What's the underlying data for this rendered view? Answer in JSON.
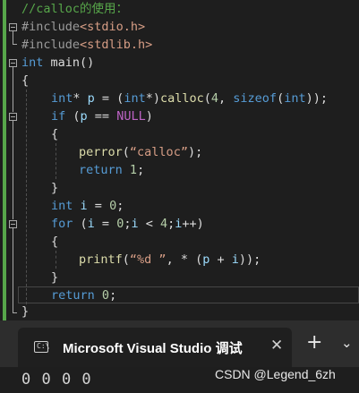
{
  "editor": {
    "comment": "//calloc的使用：",
    "inc1_kw": "#include",
    "inc1_file": "<stdio.h>",
    "inc2_kw": "#include",
    "inc2_file": "<stdlib.h>",
    "main_type": "int",
    "main_name": " main()",
    "brace_open": "{",
    "l5_a": "int",
    "l5_b": "* ",
    "l5_c": "p",
    "l5_d": " = (",
    "l5_e": "int",
    "l5_f": "*)",
    "l5_g": "calloc",
    "l5_h": "(",
    "l5_i": "4",
    "l5_j": ", ",
    "l5_k": "sizeof",
    "l5_l": "(",
    "l5_m": "int",
    "l5_n": "));",
    "l6_a": "if",
    "l6_b": " (",
    "l6_c": "p",
    "l6_d": " == ",
    "l6_e": "NULL",
    "l6_f": ")",
    "l7": "{",
    "l8_a": "perror",
    "l8_b": "(",
    "l8_c": "“calloc”",
    "l8_d": ");",
    "l9_a": "return",
    "l9_b": " ",
    "l9_c": "1",
    "l9_d": ";",
    "l10": "}",
    "l11_a": "int",
    "l11_b": " ",
    "l11_c": "i",
    "l11_d": " = ",
    "l11_e": "0",
    "l11_f": ";",
    "l12_a": "for",
    "l12_b": " (",
    "l12_c": "i",
    "l12_d": " = ",
    "l12_e": "0",
    "l12_f": ";",
    "l12_g": "i",
    "l12_h": " < ",
    "l12_i": "4",
    "l12_j": ";",
    "l12_k": "i",
    "l12_l": "++)",
    "l13": "{",
    "l14_a": "printf",
    "l14_b": "(",
    "l14_c": "“%d ”",
    "l14_d": ", * (",
    "l14_e": "p",
    "l14_f": " + ",
    "l14_g": "i",
    "l14_h": "));",
    "l15": "}",
    "l16_a": "return",
    "l16_b": " ",
    "l16_c": "0",
    "l16_d": ";",
    "l17": "}"
  },
  "terminal": {
    "tab_title": "Microsoft Visual Studio 调试‪",
    "tab_icon_text": "C:\\",
    "close": "✕",
    "add": "+",
    "dropdown": "⌄",
    "output": "0 0 0 0"
  },
  "watermark": "CSDN @Legend_6zh",
  "icons": {
    "tab_icon": "terminal-icon",
    "close": "close-icon",
    "add": "plus-icon",
    "dropdown": "chevron-down-icon"
  }
}
